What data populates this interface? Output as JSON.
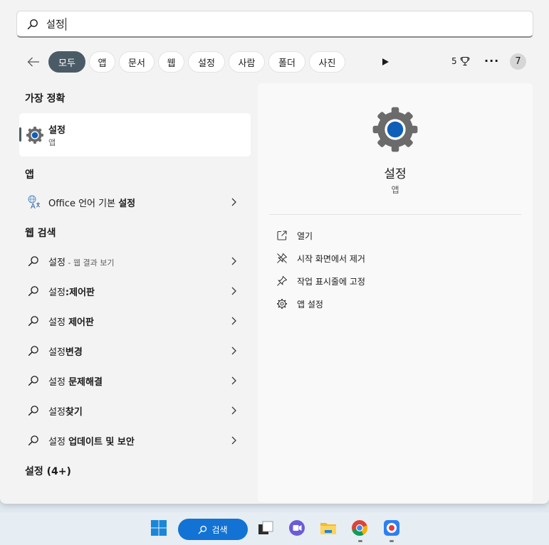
{
  "search": {
    "value": "설정"
  },
  "filters": {
    "tabs": [
      "모두",
      "앱",
      "문서",
      "웹",
      "설정",
      "사람",
      "폴더",
      "사진"
    ],
    "active_index": 0,
    "points": "5",
    "more": "···",
    "avatar": "7"
  },
  "left": {
    "best_match_title": "가장 정확",
    "best_match": {
      "name": "설정",
      "type": "앱"
    },
    "apps_title": "앱",
    "apps": [
      {
        "prefix": "Office 언어 기본 ",
        "bold": "설정"
      }
    ],
    "web_title": "웹 검색",
    "web": [
      {
        "prefix": "설정",
        "bold": "",
        "hint": " - 웹 결과 보기"
      },
      {
        "prefix": "설정",
        "bold": ":제어판",
        "hint": ""
      },
      {
        "prefix": "설정 ",
        "bold": "제어판",
        "hint": ""
      },
      {
        "prefix": "설정",
        "bold": "변경",
        "hint": ""
      },
      {
        "prefix": "설정 ",
        "bold": "문제해결",
        "hint": ""
      },
      {
        "prefix": "설정",
        "bold": "찾기",
        "hint": ""
      },
      {
        "prefix": "설정 ",
        "bold": "업데이트 및 보안",
        "hint": ""
      }
    ],
    "settings_title": "설정 (4+)"
  },
  "right": {
    "title": "설정",
    "type": "앱",
    "actions": [
      "열기",
      "시작 화면에서 제거",
      "작업 표시줄에 고정",
      "앱 설정"
    ]
  },
  "taskbar": {
    "search_label": "검색"
  },
  "colors": {
    "accent": "#4b5b66",
    "gear": "#6b6b6b",
    "gear_center": "#0f5fb8",
    "taskbar_search": "#1273d4"
  }
}
